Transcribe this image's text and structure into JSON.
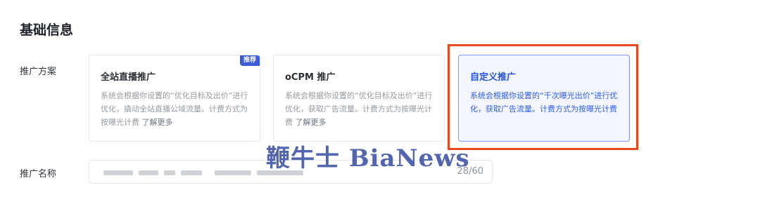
{
  "section": {
    "title": "基础信息"
  },
  "plan": {
    "label": "推广方案",
    "cards": [
      {
        "title": "全站直播推广",
        "badge": "推荐",
        "description": "系统会根据你设置的“优化目标及出价”进行优化，撬动全站直播公域流量。计费方式为按曝光计费",
        "learn_more": "了解更多",
        "selected": false
      },
      {
        "title": "oCPM 推广",
        "description": "系统会根据你设置的“优化目标及出价”进行优化，获取广告流量。计费方式为按曝光计费",
        "learn_more": "了解更多",
        "selected": false
      },
      {
        "title": "自定义推广",
        "description": "系统会根据你设置的“千次曝光出价”进行优化，获取广告流量。计费方式为按曝光计费",
        "selected": true
      }
    ]
  },
  "promotion_name": {
    "label": "推广名称",
    "counter": "28/60"
  },
  "watermark": "鞭牛士 BiaNews",
  "colors": {
    "accent": "#2352e0",
    "highlight_border": "#e8491e",
    "badge": "#3b5bdb"
  }
}
